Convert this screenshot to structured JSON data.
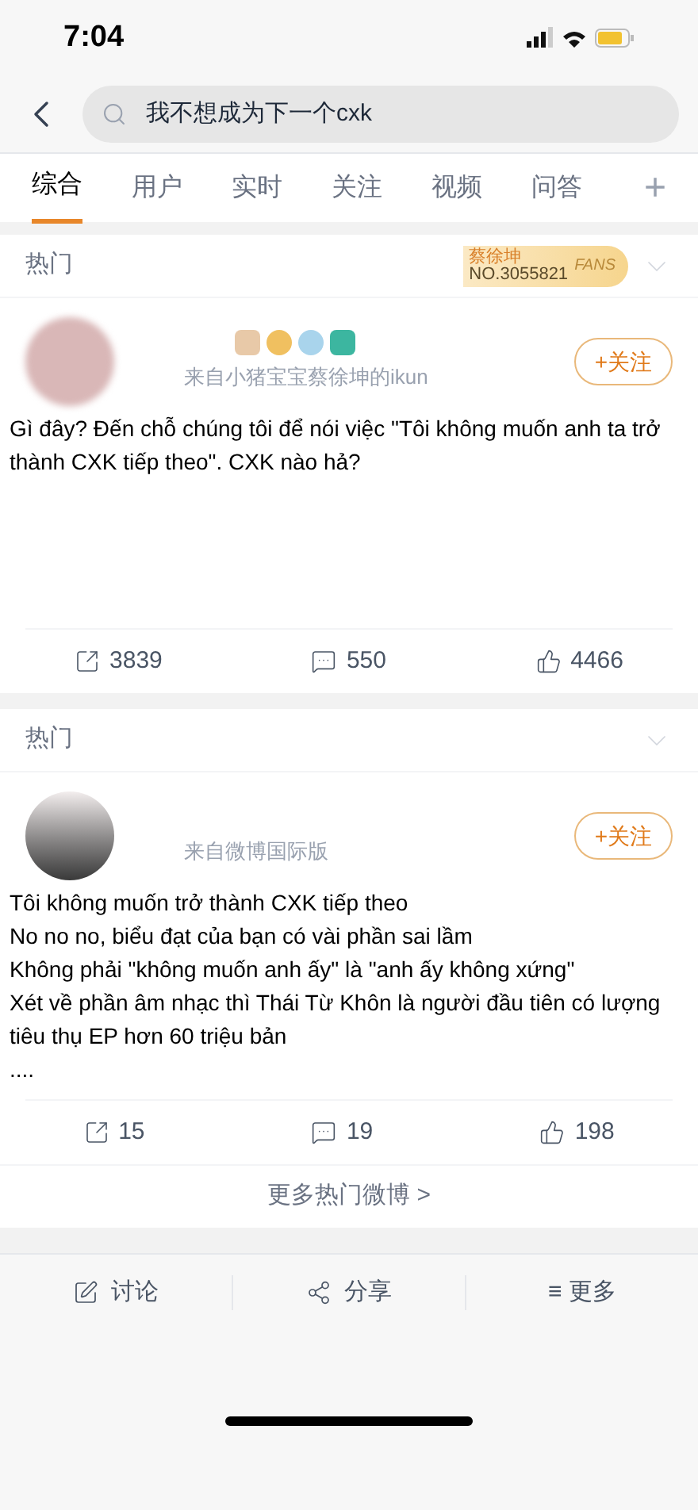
{
  "status_bar": {
    "time": "7:04"
  },
  "search": {
    "value": "我不想成为下一个cxk"
  },
  "tabs": [
    {
      "label": "综合",
      "selected": true
    },
    {
      "label": "用户",
      "selected": false
    },
    {
      "label": "实时",
      "selected": false
    },
    {
      "label": "关注",
      "selected": false
    },
    {
      "label": "视频",
      "selected": false
    },
    {
      "label": "问答",
      "selected": false
    }
  ],
  "add_tab": "+",
  "posts": [
    {
      "section": "热门",
      "fan_badge": {
        "name": "蔡徐坤",
        "number": "NO.3055821",
        "label": "FANS"
      },
      "badges": true,
      "source": "来自小猪宝宝蔡徐坤的ikun",
      "follow": "+关注",
      "lines": [
        "Gì đây? Đến chỗ chúng tôi để nói việc \"Tôi không muốn anh ta trở thành CXK tiếp theo\". CXK nào hả?"
      ],
      "reposts": "3839",
      "comments": "550",
      "likes": "4466"
    },
    {
      "section": "热门",
      "badges": false,
      "source": "来自微博国际版",
      "follow": "+关注",
      "lines": [
        "Tôi không muốn trở thành CXK tiếp theo",
        "No no no, biểu đạt của bạn có vài phần sai lầm",
        "Không phải \"không muốn anh ấy\" là \"anh ấy không xứng\"",
        "Xét về phần âm nhạc thì Thái Từ Khôn là người đầu tiên có lượng tiêu thụ EP hơn 60 triệu bản",
        "...."
      ],
      "reposts": "15",
      "comments": "19",
      "likes": "198"
    }
  ],
  "more_link": "更多热门微博 >",
  "bottom_bar": [
    {
      "kind": "discuss",
      "label": "讨论"
    },
    {
      "kind": "share",
      "label": "分享"
    },
    {
      "kind": "more",
      "label": "≡ 更多"
    }
  ]
}
